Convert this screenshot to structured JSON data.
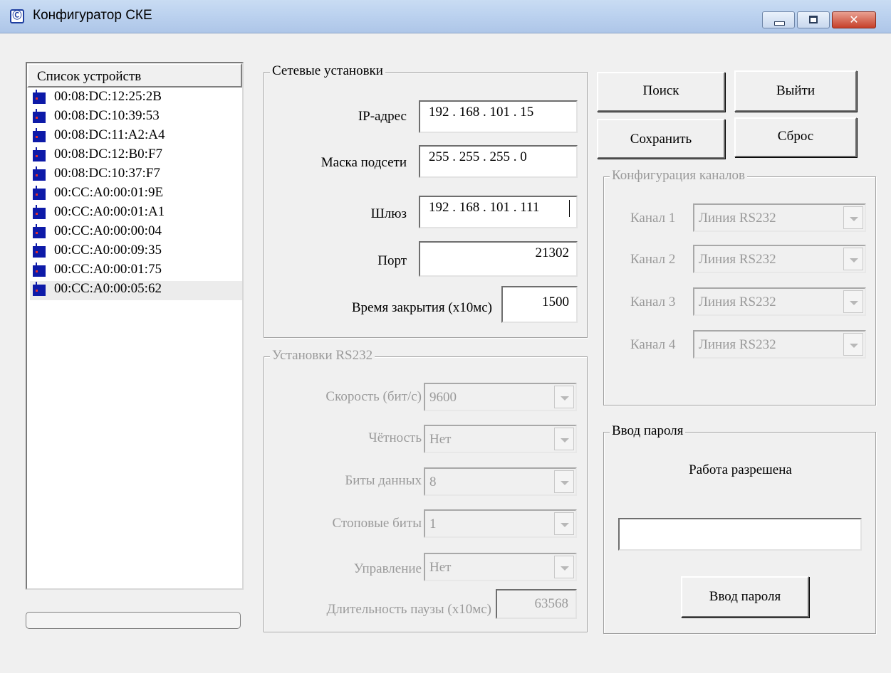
{
  "window": {
    "title": "Конфигуратор СКЕ",
    "app_icon": "app-logo-icon",
    "controls": {
      "minimize": "minimize-icon",
      "maximize": "maximize-icon",
      "close": "close-icon",
      "close_glyph": "✕"
    }
  },
  "devices": {
    "header": "Список устройств",
    "items": [
      "00:08:DC:12:25:2B",
      "00:08:DC:10:39:53",
      "00:08:DC:11:A2:A4",
      "00:08:DC:12:B0:F7",
      "00:08:DC:10:37:F7",
      "00:CC:A0:00:01:9E",
      "00:CC:A0:00:01:A1",
      "00:CC:A0:00:00:04",
      "00:CC:A0:00:09:35",
      "00:CC:A0:00:01:75",
      "00:CC:A0:00:05:62"
    ],
    "selected_index": 10,
    "item_icon": "network-device-icon",
    "progress": 0
  },
  "network": {
    "legend": "Сетевые установки",
    "ip_label": "IP-адрес",
    "ip_value": "192 . 168 . 101 .  15",
    "mask_label": "Маска подсети",
    "mask_value": "255 . 255 . 255 .   0",
    "gateway_label": "Шлюз",
    "gateway_value": "192 . 168 . 101 . 111",
    "port_label": "Порт",
    "port_value": "21302",
    "timeout_label": "Время закрытия (x10мс)",
    "timeout_value": "1500"
  },
  "rs232": {
    "legend": "Установки RS232",
    "speed_label": "Скорость (бит/с)",
    "speed_value": "9600",
    "parity_label": "Чётность",
    "parity_value": "Нет",
    "databits_label": "Биты данных",
    "databits_value": "8",
    "stopbits_label": "Стоповые биты",
    "stopbits_value": "1",
    "control_label": "Управление",
    "control_value": "Нет",
    "pause_label": "Длительность паузы (x10мс)",
    "pause_value": "63568"
  },
  "buttons": {
    "search": "Поиск",
    "exit": "Выйти",
    "save": "Сохранить",
    "reset": "Сброс"
  },
  "channels": {
    "legend": "Конфигурация каналов",
    "items": [
      {
        "label": "Канал 1",
        "value": "Линия RS232"
      },
      {
        "label": "Канал 2",
        "value": "Линия RS232"
      },
      {
        "label": "Канал 3",
        "value": "Линия RS232"
      },
      {
        "label": "Канал 4",
        "value": "Линия RS232"
      }
    ]
  },
  "password": {
    "legend": "Ввод пароля",
    "status": "Работа разрешена",
    "input_value": "",
    "button": "Ввод пароля"
  }
}
